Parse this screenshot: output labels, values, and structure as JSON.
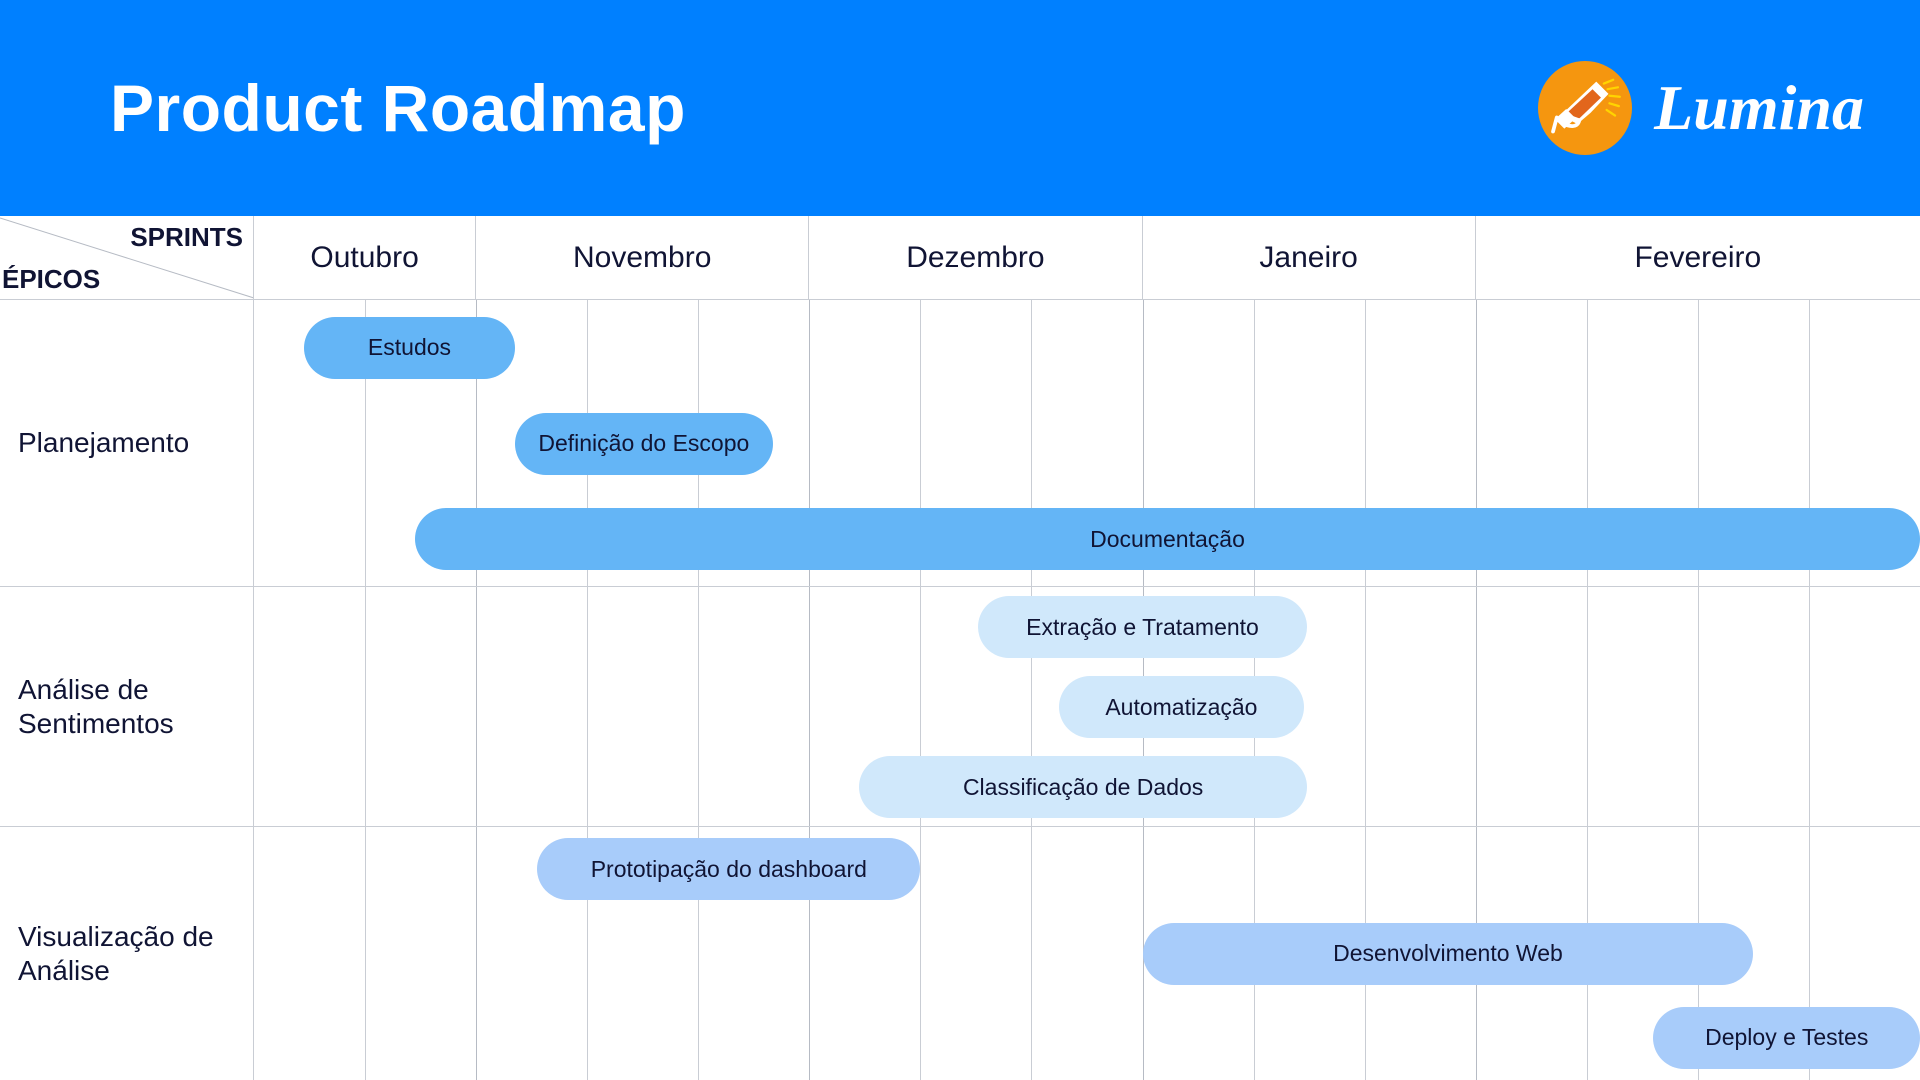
{
  "header": {
    "title": "Product Roadmap",
    "brand_name": "Lumina",
    "brand_icon": "megaphone-icon",
    "bg_color": "#0080ff",
    "logo_circle_color": "#f5960f"
  },
  "corner": {
    "columns_label": "SPRINTS",
    "rows_label": "ÉPICOS"
  },
  "timeline": {
    "months": [
      {
        "label": "Outubro",
        "sprints": 2
      },
      {
        "label": "Novembro",
        "sprints": 3
      },
      {
        "label": "Dezembro",
        "sprints": 3
      },
      {
        "label": "Janeiro",
        "sprints": 3
      },
      {
        "label": "Fevereiro",
        "sprints": 4
      }
    ],
    "sprint_count": 15
  },
  "chart_data": {
    "type": "gantt",
    "title": "Product Roadmap",
    "xlabel": "SPRINTS",
    "ylabel": "ÉPICOS",
    "grid": true,
    "categories": [
      "Outubro",
      "Novembro",
      "Dezembro",
      "Janeiro",
      "Fevereiro"
    ],
    "x_units": "sprint",
    "x_range": [
      0,
      15
    ],
    "rows": [
      {
        "label": "Planejamento",
        "color": "#64b5f6",
        "tasks": [
          {
            "name": "Estudos",
            "start": 0.45,
            "end": 2.35,
            "color": "#64b5f6"
          },
          {
            "name": "Definição do Escopo",
            "start": 2.35,
            "end": 4.67,
            "color": "#64b5f6"
          },
          {
            "name": "Documentação",
            "start": 1.45,
            "end": 15.0,
            "color": "#64b5f6"
          }
        ]
      },
      {
        "label": "Análise de Sentimentos",
        "color": "#d0e8fb",
        "tasks": [
          {
            "name": "Extração e Tratamento",
            "start": 6.52,
            "end": 9.48,
            "color": "#d0e8fb"
          },
          {
            "name": "Automatização",
            "start": 7.25,
            "end": 9.45,
            "color": "#d0e8fb"
          },
          {
            "name": "Classificação de Dados",
            "start": 5.45,
            "end": 9.48,
            "color": "#d0e8fb"
          }
        ]
      },
      {
        "label": "Visualização de Análise",
        "color": "#a8ccfa",
        "tasks": [
          {
            "name": "Prototipação do dashboard",
            "start": 2.55,
            "end": 6.0,
            "color": "#a8ccfa"
          },
          {
            "name": "Desenvolvimento Web",
            "start": 8.0,
            "end": 13.5,
            "color": "#a8ccfa"
          },
          {
            "name": "Deploy e Testes",
            "start": 12.6,
            "end": 15.0,
            "color": "#a8ccfa"
          }
        ]
      }
    ]
  }
}
